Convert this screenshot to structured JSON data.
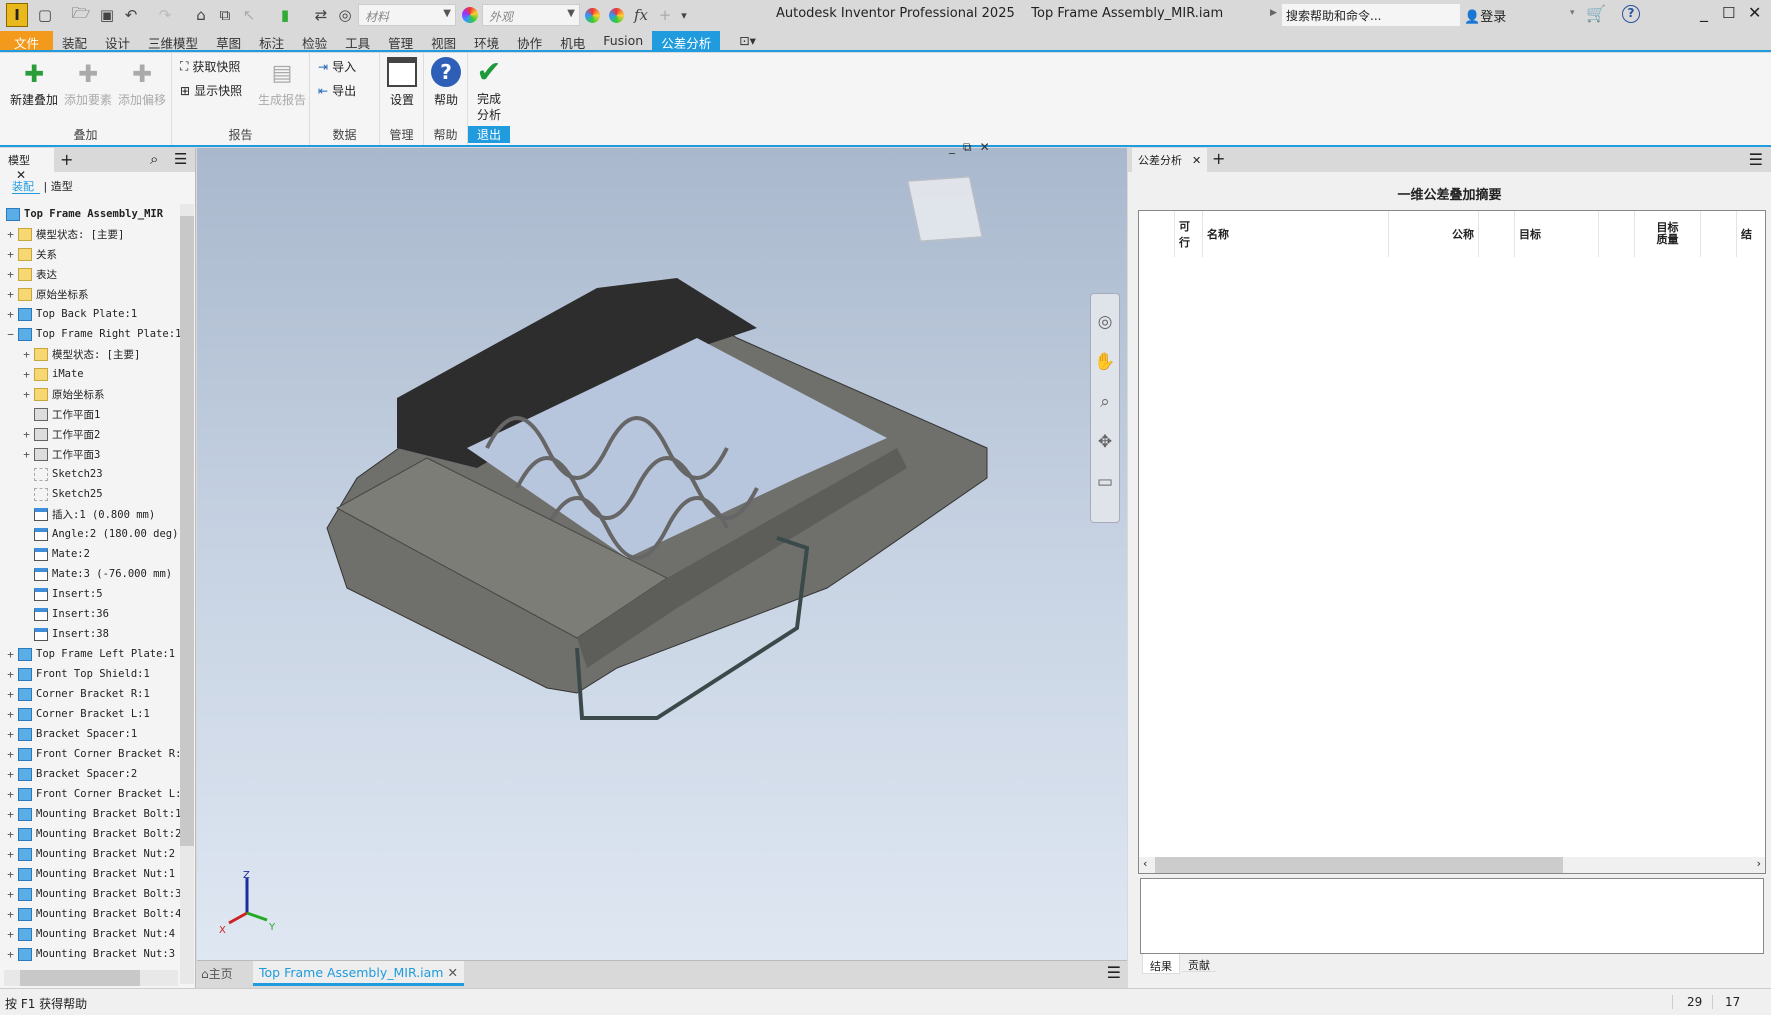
{
  "app": {
    "title": "Autodesk Inventor Professional 2025",
    "document": "Top Frame Assembly_MIR.iam"
  },
  "quick_access": {
    "material_combo": "材料",
    "appearance_combo": "外观",
    "search_placeholder": "搜索帮助和命令...",
    "login": "登录"
  },
  "ribbon_tabs": [
    "文件",
    "装配",
    "设计",
    "三维模型",
    "草图",
    "标注",
    "检验",
    "工具",
    "管理",
    "视图",
    "环境",
    "协作",
    "机电",
    "Fusion",
    "公差分析"
  ],
  "active_tab": "公差分析",
  "ribbon": {
    "groups": {
      "stack": "叠加",
      "report": "报告",
      "data": "数据",
      "manage": "管理",
      "help": "帮助",
      "exit": "退出"
    },
    "buttons": {
      "new_stack": "新建叠加",
      "add_feature": "添加要素",
      "add_offset": "添加偏移",
      "get_snapshot": "获取快照",
      "show_snapshot": "显示快照",
      "gen_report": "生成报告",
      "import": "导入",
      "export": "导出",
      "settings": "设置",
      "help": "帮助",
      "finish1": "完成",
      "finish2": "分析"
    }
  },
  "browser": {
    "tab": "模型",
    "sub_tabs": [
      "装配",
      "造型"
    ],
    "root": "Top Frame Assembly_MIR",
    "items": [
      {
        "label": "模型状态: [主要]",
        "icon": "folder",
        "level": 0,
        "exp": "+"
      },
      {
        "label": "关系",
        "icon": "folder",
        "level": 0,
        "exp": "+"
      },
      {
        "label": "表达",
        "icon": "folder",
        "level": 0,
        "exp": "+"
      },
      {
        "label": "原始坐标系",
        "icon": "folder",
        "level": 0,
        "exp": "+"
      },
      {
        "label": "Top Back Plate:1",
        "icon": "part",
        "level": 0,
        "exp": "+"
      },
      {
        "label": "Top Frame Right Plate:1",
        "icon": "part",
        "level": 0,
        "exp": "−"
      },
      {
        "label": "模型状态: [主要]",
        "icon": "folder",
        "level": 1,
        "exp": "+"
      },
      {
        "label": "iMate",
        "icon": "folder",
        "level": 1,
        "exp": "+"
      },
      {
        "label": "原始坐标系",
        "icon": "folder",
        "level": 1,
        "exp": "+"
      },
      {
        "label": "工作平面1",
        "icon": "plane",
        "level": 1,
        "exp": ""
      },
      {
        "label": "工作平面2",
        "icon": "plane",
        "level": 1,
        "exp": "+"
      },
      {
        "label": "工作平面3",
        "icon": "plane",
        "level": 1,
        "exp": "+"
      },
      {
        "label": "Sketch23",
        "icon": "sketch",
        "level": 1,
        "exp": ""
      },
      {
        "label": "Sketch25",
        "icon": "sketch",
        "level": 1,
        "exp": ""
      },
      {
        "label": "插入:1 (0.800 mm)",
        "icon": "cons",
        "level": 1,
        "exp": ""
      },
      {
        "label": "Angle:2 (180.00 deg)",
        "icon": "cons",
        "level": 1,
        "exp": ""
      },
      {
        "label": "Mate:2",
        "icon": "cons",
        "level": 1,
        "exp": ""
      },
      {
        "label": "Mate:3 (-76.000 mm)",
        "icon": "cons",
        "level": 1,
        "exp": ""
      },
      {
        "label": "Insert:5",
        "icon": "cons",
        "level": 1,
        "exp": ""
      },
      {
        "label": "Insert:36",
        "icon": "cons",
        "level": 1,
        "exp": ""
      },
      {
        "label": "Insert:38",
        "icon": "cons",
        "level": 1,
        "exp": ""
      },
      {
        "label": "Top Frame Left Plate:1",
        "icon": "part",
        "level": 0,
        "exp": "+"
      },
      {
        "label": "Front Top Shield:1",
        "icon": "part",
        "level": 0,
        "exp": "+"
      },
      {
        "label": "Corner Bracket R:1",
        "icon": "part",
        "level": 0,
        "exp": "+"
      },
      {
        "label": "Corner Bracket L:1",
        "icon": "part",
        "level": 0,
        "exp": "+"
      },
      {
        "label": "Bracket Spacer:1",
        "icon": "part",
        "level": 0,
        "exp": "+"
      },
      {
        "label": "Front Corner Bracket R:",
        "icon": "part",
        "level": 0,
        "exp": "+"
      },
      {
        "label": "Bracket Spacer:2",
        "icon": "part",
        "level": 0,
        "exp": "+"
      },
      {
        "label": "Front Corner Bracket L:",
        "icon": "part",
        "level": 0,
        "exp": "+"
      },
      {
        "label": "Mounting Bracket Bolt:1",
        "icon": "part",
        "level": 0,
        "exp": "+"
      },
      {
        "label": "Mounting Bracket Bolt:2",
        "icon": "part",
        "level": 0,
        "exp": "+"
      },
      {
        "label": "Mounting Bracket Nut:2",
        "icon": "part",
        "level": 0,
        "exp": "+"
      },
      {
        "label": "Mounting Bracket Nut:1",
        "icon": "part",
        "level": 0,
        "exp": "+"
      },
      {
        "label": "Mounting Bracket Bolt:3",
        "icon": "part",
        "level": 0,
        "exp": "+"
      },
      {
        "label": "Mounting Bracket Bolt:4",
        "icon": "part",
        "level": 0,
        "exp": "+"
      },
      {
        "label": "Mounting Bracket Nut:4",
        "icon": "part",
        "level": 0,
        "exp": "+"
      },
      {
        "label": "Mounting Bracket Nut:3",
        "icon": "part",
        "level": 0,
        "exp": "+"
      }
    ]
  },
  "doc_tabs": {
    "home": "主页",
    "document": "Top Frame Assembly_MIR.iam"
  },
  "axes": {
    "x": "X",
    "y": "Y",
    "z": "Z"
  },
  "tolerance_panel": {
    "tab": "公差分析",
    "title": "一维公差叠加摘要",
    "columns": [
      "可行",
      "名称",
      "公称",
      "目标",
      "目标\n质量",
      "结"
    ],
    "bottom_tabs": [
      "结果",
      "贡献"
    ]
  },
  "status": {
    "help": "按 F1 获得帮助",
    "count1": "29",
    "count2": "17"
  },
  "colors": {
    "accent": "#1f9bde",
    "file_tab": "#f39a1d"
  }
}
